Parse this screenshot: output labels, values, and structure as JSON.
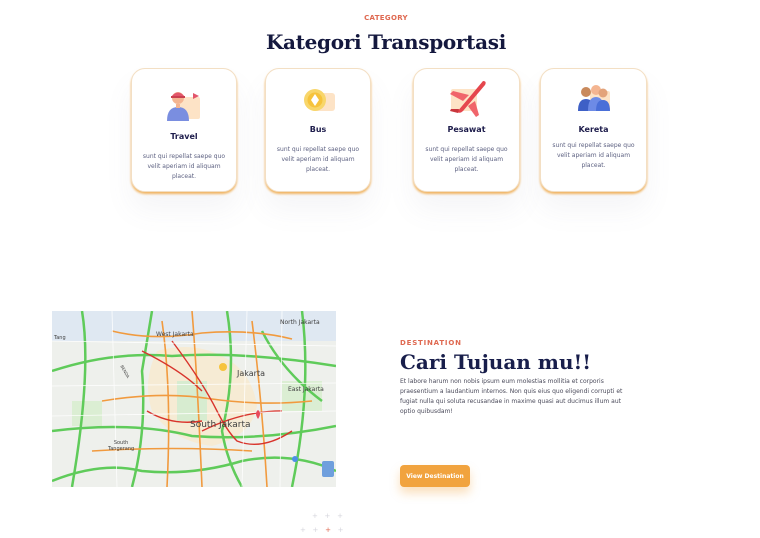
{
  "category": {
    "eyebrow": "CATEGORY",
    "title": "Kategori Transportasi",
    "cards": [
      {
        "title": "Travel",
        "description": "sunt qui repellat saepe quo velit aperiam id aliquam placeat.",
        "icon": "traveler-icon"
      },
      {
        "title": "Bus",
        "description": "sunt qui repellat saepe quo velit aperiam id aliquam placeat.",
        "icon": "bus-icon"
      },
      {
        "title": "Pesawat",
        "description": "sunt qui repellat saepe quo velit aperiam id aliquam placeat.",
        "icon": "airplane-icon"
      },
      {
        "title": "Kereta",
        "description": "sunt qui repellat saepe quo velit aperiam id aliquam placeat.",
        "icon": "train-passengers-icon"
      }
    ]
  },
  "map": {
    "labels": {
      "north_jakarta": "North Jakarta",
      "west_jakarta": "West Jakarta",
      "jakarta": "Jakarta",
      "east_jakarta": "East Jakarta",
      "south_jakarta": "South Jakarta",
      "south_tangerang": "South\nTangerang",
      "tanggerang_left": "Tang",
      "bekasi_small": "BENDA"
    }
  },
  "destination": {
    "eyebrow": "DESTINATION",
    "title": "Cari Tujuan mu!!",
    "text": "Et labore harum non nobis ipsum eum molestias mollitia et corporis praesentium a laudantium internos. Non quis eius quo eligendi corrupti et fugiat nulla qui soluta recusandae in maxime quasi aut ducimus illum aut optio quibusdam!",
    "button_label": "View Destination"
  },
  "colors": {
    "accent": "#df6951",
    "button": "#f1a33e",
    "title": "#14183e",
    "card_border": "#f1b563"
  }
}
